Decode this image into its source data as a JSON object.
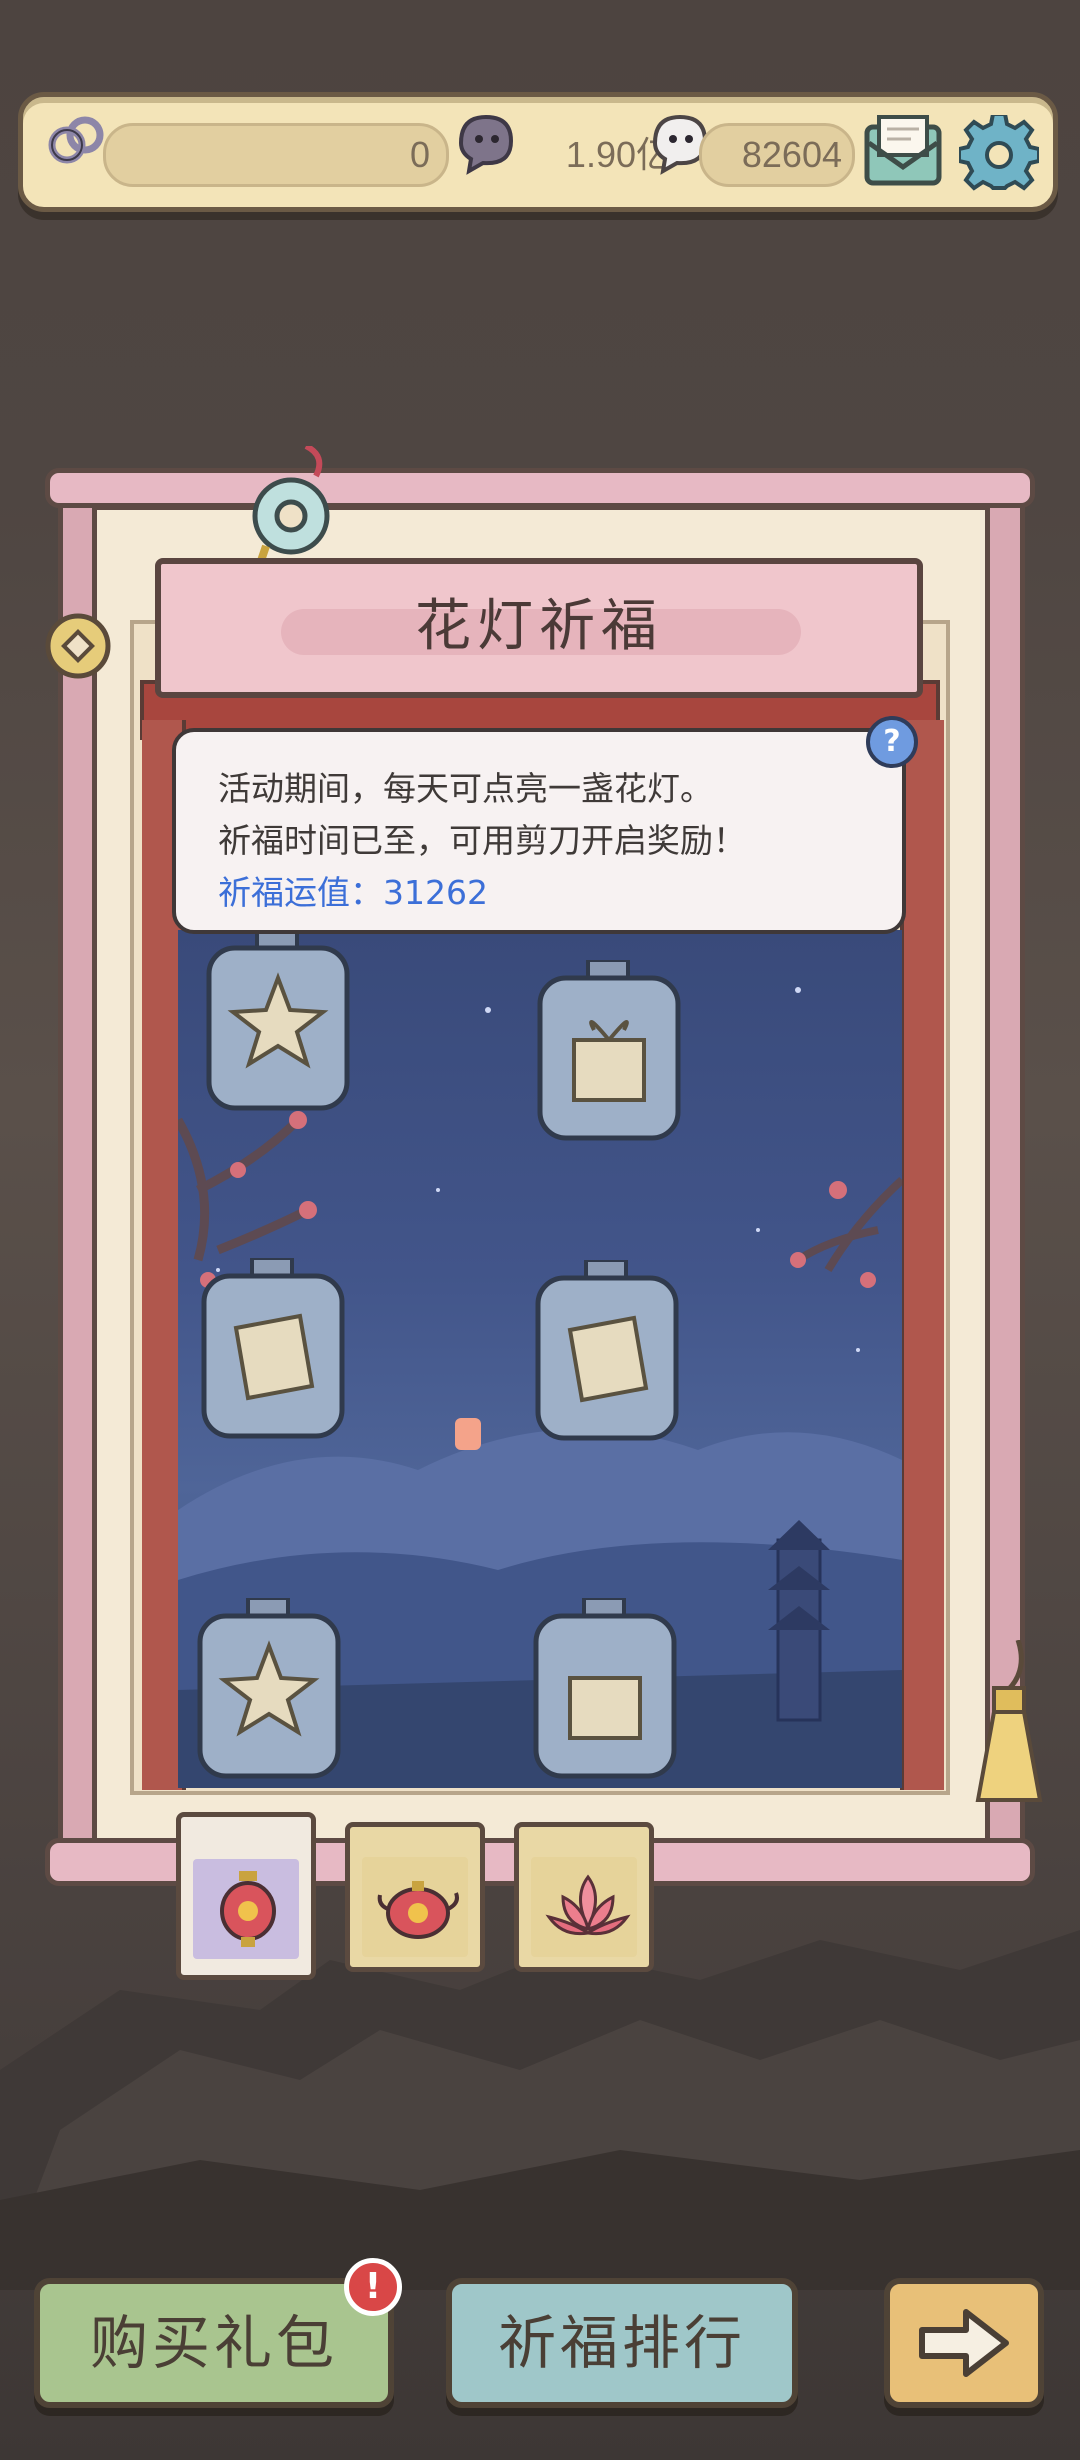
{
  "topbar": {
    "resource1_value": "0",
    "resource2_value": "1.90亿",
    "resource3_value": "82604"
  },
  "panel": {
    "title": "花灯祈福",
    "info_line_1": "活动期间，每天可点亮一盏花灯。",
    "info_line_2": "祈福时间已至，可用剪刀开启奖励！",
    "luck_label": "祈福运值：31262",
    "help_symbol": "?"
  },
  "tabs": [
    {
      "icon": "red-lantern-icon",
      "active": true
    },
    {
      "icon": "teapot-lantern-icon",
      "active": false
    },
    {
      "icon": "lotus-lantern-icon",
      "active": false
    }
  ],
  "buttons": {
    "buy_pack": "购买礼包",
    "ranking": "祈福排行",
    "alert_symbol": "!"
  },
  "colors": {
    "accent_blue": "#3c6fd8",
    "alert_red": "#d94747",
    "buy_green": "#a9c58f",
    "rank_teal": "#9fc7c9",
    "next_gold": "#e8c078"
  }
}
